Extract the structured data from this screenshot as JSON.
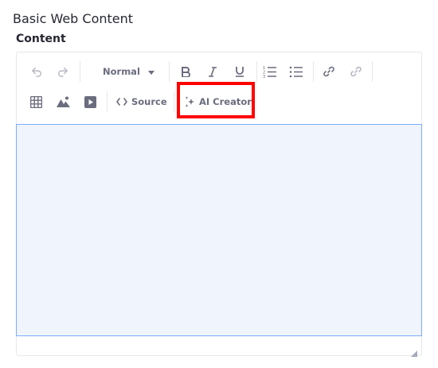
{
  "page": {
    "title": "Basic Web Content"
  },
  "field": {
    "label": "Content"
  },
  "toolbar": {
    "format_select": {
      "value": "Normal"
    },
    "source_label": "Source",
    "ai_creator_label": "AI Creator",
    "icons": [
      "undo-icon",
      "redo-icon",
      "bold-icon",
      "italic-icon",
      "underline-icon",
      "numbered-list-icon",
      "bulleted-list-icon",
      "link-icon",
      "unlink-icon",
      "table-icon",
      "image-icon",
      "video-icon",
      "code-icon",
      "sparkle-icon"
    ]
  },
  "colors": {
    "highlight_border": "#ff0000",
    "editor_area_background": "#eff4fd",
    "editor_area_border": "#80acff",
    "icon": "#6b6c7e",
    "icon_disabled": "#b7b8c3"
  }
}
